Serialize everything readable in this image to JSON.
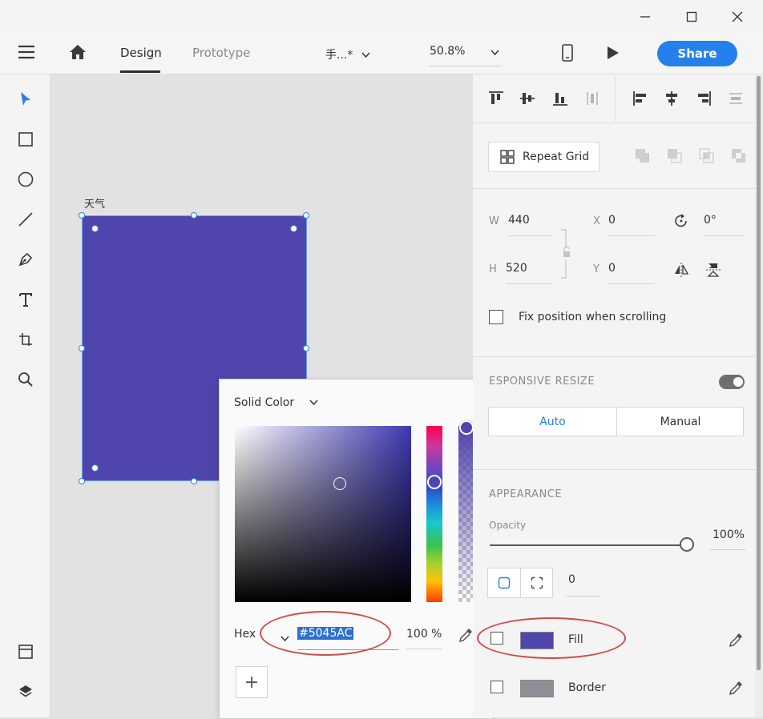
{
  "window": {
    "minimize_icon": "minimize-icon",
    "maximize_icon": "maximize-icon",
    "close_icon": "close-icon"
  },
  "appbar": {
    "tabs": [
      {
        "label": "Design",
        "active": true
      },
      {
        "label": "Prototype",
        "active": false
      }
    ],
    "doc_title": "手...*",
    "zoom": "50.8%",
    "share_label": "Share",
    "accent": "#2680eb"
  },
  "canvas": {
    "artboard_label": "天气",
    "fill_color": "#5045ac"
  },
  "color_picker": {
    "mode": "Solid Color",
    "format_label": "Hex",
    "hex_value": "#5045AC",
    "alpha_value": "100 %",
    "add_label": "+"
  },
  "panel": {
    "repeat_grid_label": "Repeat Grid",
    "w_label": "W",
    "w_value": "440",
    "h_label": "H",
    "h_value": "520",
    "x_label": "X",
    "x_value": "0",
    "y_label": "Y",
    "y_value": "0",
    "rotation_value": "0°",
    "fix_position_label": "Fix position when scrolling",
    "responsive_title": "ESPONSIVE RESIZE",
    "responsive_on": true,
    "seg_auto": "Auto",
    "seg_manual": "Manual",
    "appearance_title": "APPEARANCE",
    "opacity_label": "Opacity",
    "opacity_value": "100%",
    "opacity_level": 1.0,
    "corner_radius_value": "0",
    "fill_label": "Fill",
    "fill_color": "#5045ac",
    "border_label": "Border",
    "border_color": "#8e8e96"
  }
}
